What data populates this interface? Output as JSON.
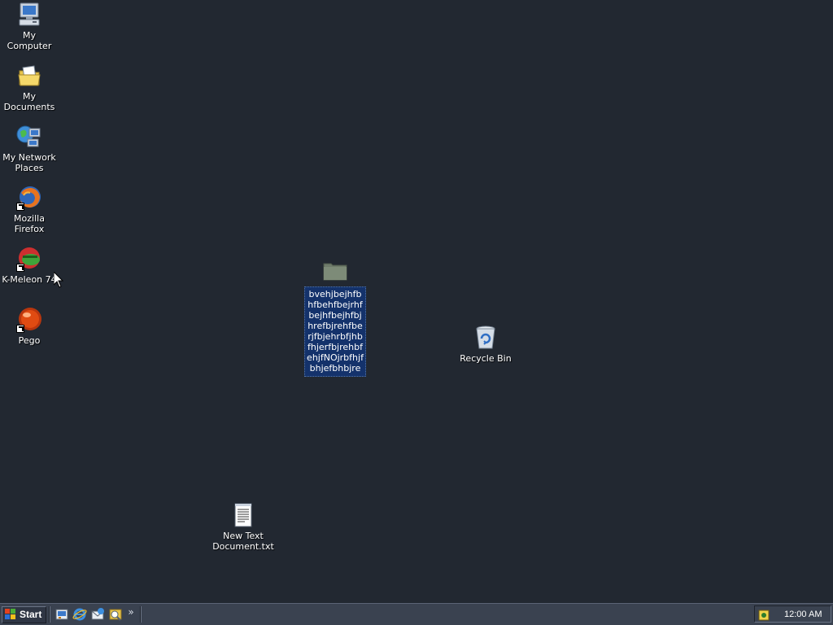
{
  "desktop": {
    "icons": [
      {
        "label": "My Computer",
        "icon": "computer-icon"
      },
      {
        "label": "My Documents",
        "icon": "documents-folder-icon"
      },
      {
        "label": "My Network Places",
        "icon": "network-places-icon"
      },
      {
        "label": "Mozilla Firefox",
        "icon": "firefox-icon",
        "shortcut": true
      },
      {
        "label": "K-Meleon 74",
        "icon": "kmeleon-icon",
        "shortcut": true
      },
      {
        "label": "Pego",
        "icon": "pego-icon",
        "shortcut": true
      },
      {
        "label": "bvehjbejhfbhfbehfbejrhfbejhfbejhfbjhrefbjrehfberjfbjehrbfjhbfhjerfbjrehbfehjfNOjrbfhjfbhjefbhbjre",
        "icon": "folder-icon",
        "selected": true
      },
      {
        "label": "Recycle Bin",
        "icon": "recycle-bin-icon"
      },
      {
        "label": "New Text Document.txt",
        "icon": "text-document-icon"
      }
    ]
  },
  "taskbar": {
    "start_label": "Start",
    "quick_launch": [
      "show-desktop-icon",
      "internet-explorer-icon",
      "outlook-express-icon",
      "media-icon"
    ],
    "overflow": "»",
    "tray_icon": "security-tray-icon",
    "clock": "12:00 AM"
  },
  "colors": {
    "desktop_background": "#222831",
    "taskbar": "#3a4250",
    "selection": "#14326b"
  }
}
